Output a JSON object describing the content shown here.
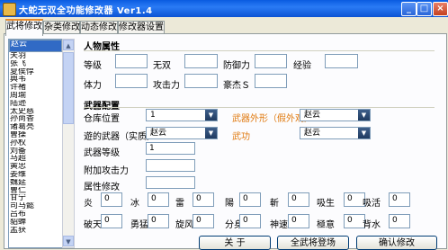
{
  "window": {
    "title": "大蛇无双全功能修改器 Ver1.4",
    "min": "_",
    "max": "□",
    "close": "×"
  },
  "tabs": [
    "武将修改",
    "杂类修改",
    "动态修改",
    "修改器设置"
  ],
  "list": {
    "items": [
      "赵云",
      "关羽",
      "张飞",
      "夏侯惇",
      "典韦",
      "许褚",
      "周瑜",
      "陆逊",
      "太史慈",
      "孙尚香",
      "诸葛亮",
      "曹操",
      "孙权",
      "刘备",
      "马超",
      "黄忠",
      "姜维",
      "魏延",
      "曹仁",
      "甘宁",
      "司马懿",
      "吕布",
      "貂蝉",
      "孟获"
    ]
  },
  "person": {
    "title": "人物属性",
    "labels": {
      "level": "等级",
      "musou": "无双",
      "defense": "防御力",
      "exp": "经验",
      "hp": "体力",
      "attack": "攻击力",
      "fame": "豪杰Ｓ"
    },
    "values": {
      "level": "",
      "musou": "",
      "defense": "",
      "exp": "",
      "hp": "",
      "attack": "",
      "fame": ""
    }
  },
  "weapon": {
    "title": "武器配置",
    "slot_label": "仓库位置",
    "slot_value": "1",
    "weapon_label": "遊的武器（实质）",
    "weapon_value": "赵云",
    "look_label": "武器外形（假外观）",
    "look_value": "赵云",
    "art_label": "武功",
    "art_value": "赵云",
    "wlevel_label": "武器等级",
    "wlevel_value": "1",
    "extra_label": "附加攻击力",
    "extra_value": "",
    "attr_label": "属性修改",
    "attr_value": ""
  },
  "attrs1": [
    {
      "label": "炎",
      "value": "0"
    },
    {
      "label": "冰",
      "value": "0"
    },
    {
      "label": "雷",
      "value": "0"
    },
    {
      "label": "陽",
      "value": "0"
    },
    {
      "label": "斬",
      "value": "0"
    },
    {
      "label": "吸生",
      "value": "0"
    },
    {
      "label": "吸活",
      "value": "0"
    }
  ],
  "attrs2": [
    {
      "label": "破天",
      "value": "0"
    },
    {
      "label": "勇猛",
      "value": "0"
    },
    {
      "label": "旋风",
      "value": "0"
    },
    {
      "label": "分身",
      "value": "0"
    },
    {
      "label": "神速",
      "value": "0"
    },
    {
      "label": "極意",
      "value": "0"
    },
    {
      "label": "背水",
      "value": "0"
    }
  ],
  "buttons": {
    "about": "关    于",
    "all_appear": "全武将登场",
    "confirm": "确认修改"
  },
  "colors": {
    "accent_tab": "#E68B2C",
    "selection": "#316AC5",
    "orange_label": "#E07A10"
  }
}
